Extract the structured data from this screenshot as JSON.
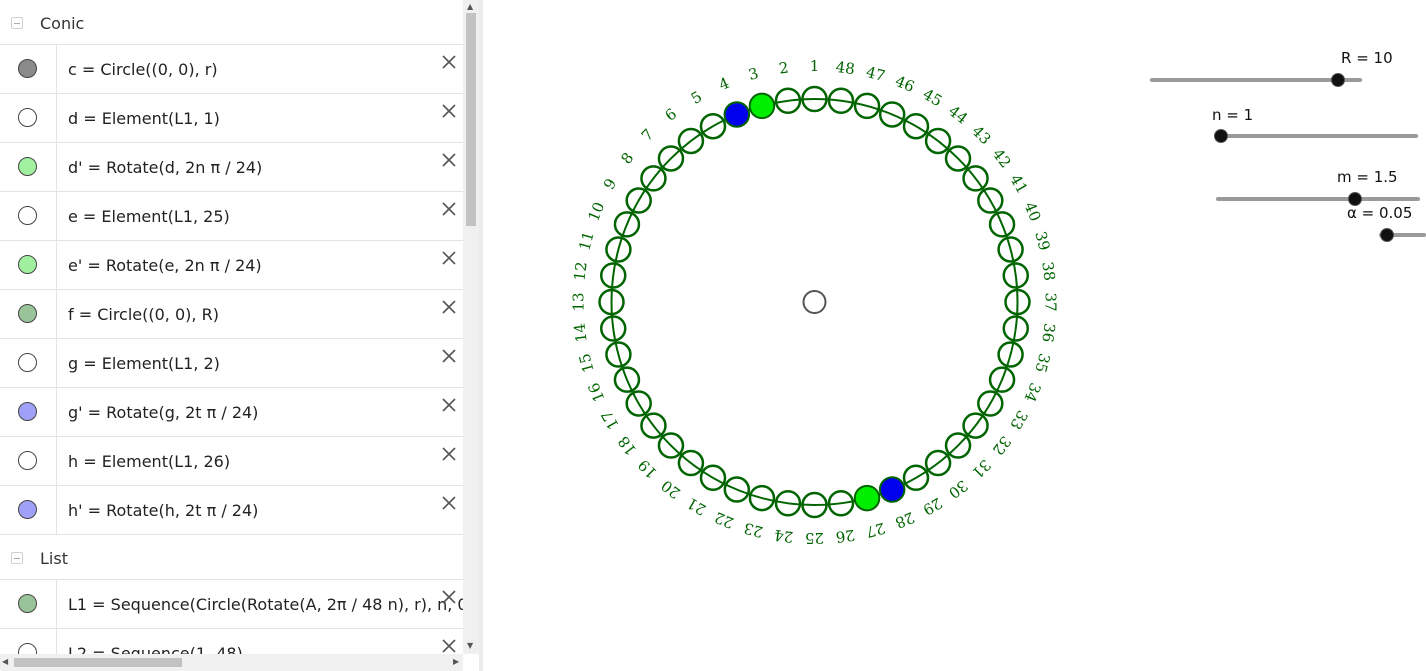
{
  "algebra": {
    "groups": [
      {
        "label": "Conic",
        "items": [
          {
            "text": "c = Circle((0, 0), r)",
            "color": "#8a8a8a"
          },
          {
            "text": "d = Element(L1, 1)",
            "color": "#ffffff"
          },
          {
            "text": "d' = Rotate(d, 2n π / 24)",
            "color": "#a0f0a0"
          },
          {
            "text": "e = Element(L1, 25)",
            "color": "#ffffff"
          },
          {
            "text": "e' = Rotate(e, 2n π / 24)",
            "color": "#a0f0a0"
          },
          {
            "text": "f = Circle((0, 0), R)",
            "color": "#99c399"
          },
          {
            "text": "g = Element(L1, 2)",
            "color": "#ffffff"
          },
          {
            "text": "g' = Rotate(g, 2t π / 24)",
            "color": "#a0a0f8"
          },
          {
            "text": "h = Element(L1, 26)",
            "color": "#ffffff"
          },
          {
            "text": "h' = Rotate(h, 2t π / 24)",
            "color": "#a0a0f8"
          }
        ]
      },
      {
        "label": "List",
        "items": [
          {
            "text": "L1 = Sequence(Circle(Rotate(A, 2π / 48 n), r), n, 0",
            "color": "#99c399"
          },
          {
            "text": "L2 = Sequence(1, 48)",
            "color": "#ffffff"
          }
        ]
      }
    ]
  },
  "sliders": [
    {
      "label": "R = 10",
      "fraction": 0.86
    },
    {
      "label": "n = 1",
      "fraction": 0.0
    },
    {
      "label": "m = 1.5",
      "fraction": 0.65
    },
    {
      "label": "α = 0.05",
      "fraction": 0.05
    }
  ],
  "canvas": {
    "colors": {
      "ring": "#006400",
      "green_point": "#00ee00",
      "blue_point": "#0000ee",
      "center": "#555555"
    },
    "small_circle_count": 48,
    "number_labels": [
      "1",
      "2",
      "3",
      "4",
      "5",
      "6",
      "7",
      "8",
      "9",
      "10",
      "11",
      "12",
      "13",
      "14",
      "15",
      "16",
      "17",
      "18",
      "19",
      "20",
      "21",
      "22",
      "23",
      "24",
      "25",
      "26",
      "27",
      "28",
      "29",
      "30",
      "31",
      "32",
      "33",
      "34",
      "35",
      "36",
      "37",
      "38",
      "39",
      "40",
      "41",
      "42",
      "43",
      "44",
      "45",
      "46",
      "47",
      "48"
    ],
    "icons": {
      "close": "close-icon",
      "collapse": "collapse-icon"
    }
  }
}
